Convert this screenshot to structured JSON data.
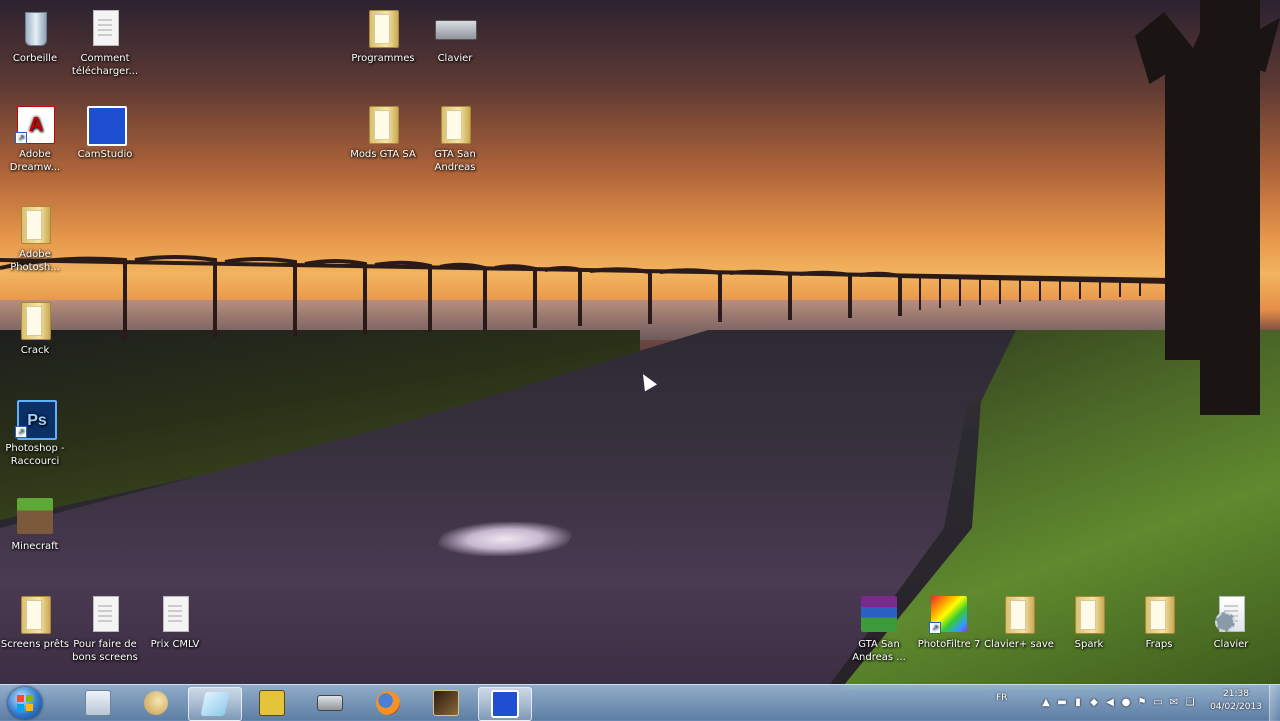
{
  "desktop": {
    "icons": [
      {
        "id": "corbeille",
        "label": "Corbeille",
        "icon": "recycle-bin-icon"
      },
      {
        "id": "comment-telecharger",
        "label": "Comment télécharger...",
        "icon": "document-icon"
      },
      {
        "id": "programmes",
        "label": "Programmes",
        "icon": "folder-icon"
      },
      {
        "id": "clavier-top",
        "label": "Clavier",
        "icon": "keyboard-icon"
      },
      {
        "id": "adobe-dreamweaver",
        "label": "Adobe Dreamw...",
        "icon": "adobe-icon"
      },
      {
        "id": "camstudio",
        "label": "CamStudio",
        "icon": "camstudio-icon"
      },
      {
        "id": "mods-gta",
        "label": "Mods GTA SA",
        "icon": "folder-icon"
      },
      {
        "id": "gta-san-andreas-folder",
        "label": "GTA San Andreas",
        "icon": "folder-icon"
      },
      {
        "id": "adobe-photoshop",
        "label": "Adobe Photosh...",
        "icon": "folder-icon"
      },
      {
        "id": "crack",
        "label": "Crack",
        "icon": "folder-icon"
      },
      {
        "id": "photoshop-raccourci",
        "label": "Photoshop - Raccourci",
        "icon": "photoshop-icon"
      },
      {
        "id": "minecraft",
        "label": "Minecraft",
        "icon": "minecraft-icon"
      },
      {
        "id": "screens-prets",
        "label": "Screens prêts",
        "icon": "folder-icon"
      },
      {
        "id": "pour-faire-screens",
        "label": "Pour faire de bons screens",
        "icon": "document-icon"
      },
      {
        "id": "prix-cmlv",
        "label": "Prix CMLV",
        "icon": "document-icon"
      },
      {
        "id": "gta-san-andreas-rar",
        "label": "GTA San Andreas ...",
        "icon": "winrar-icon"
      },
      {
        "id": "photofiltre",
        "label": "PhotoFiltre 7",
        "icon": "photofiltre-icon"
      },
      {
        "id": "clavier-save",
        "label": "Clavier+ save",
        "icon": "folder-icon"
      },
      {
        "id": "spark",
        "label": "Spark",
        "icon": "folder-icon"
      },
      {
        "id": "fraps",
        "label": "Fraps",
        "icon": "folder-icon"
      },
      {
        "id": "clavier-bottom",
        "label": "Clavier",
        "icon": "settings-icon"
      }
    ]
  },
  "taskbar": {
    "start": "start-button",
    "pinned": [
      {
        "id": "explorer",
        "icon": "library-icon",
        "color": "#d8e2ee",
        "active": false
      },
      {
        "id": "paint",
        "icon": "paint-icon",
        "color": "#e8d6a0",
        "active": false
      },
      {
        "id": "aero",
        "icon": "window-icon",
        "color": "#cfe8f5",
        "active": true
      },
      {
        "id": "fraps-app",
        "icon": "fraps-icon",
        "color": "#e6c43a",
        "active": false
      },
      {
        "id": "clavier-app",
        "icon": "keyboard-icon",
        "color": "#b9c0c8",
        "active": false
      },
      {
        "id": "firefox",
        "icon": "firefox-icon",
        "color": "#e7702a",
        "active": false
      },
      {
        "id": "gta-app",
        "icon": "gta-icon",
        "color": "#6b4b2a",
        "active": false
      },
      {
        "id": "camstudio-app",
        "icon": "camstudio-icon",
        "color": "#1e4fd0",
        "active": true
      }
    ],
    "tray": {
      "language": "FR",
      "time": "21:38",
      "date": "04/02/2013"
    }
  }
}
